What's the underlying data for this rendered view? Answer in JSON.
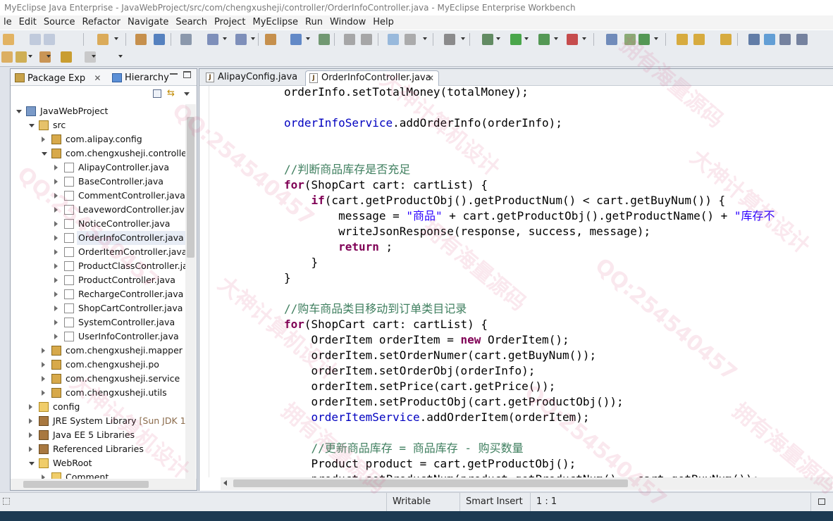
{
  "window": {
    "title": "MyEclipse Java Enterprise - JavaWebProject/src/com/chengxusheji/controller/OrderInfoController.java - MyEclipse Enterprise Workbench"
  },
  "menubar": {
    "items": [
      "le",
      "Edit",
      "Source",
      "Refactor",
      "Navigate",
      "Search",
      "Project",
      "MyEclipse",
      "Run",
      "Window",
      "Help"
    ]
  },
  "package_explorer": {
    "tabs": [
      {
        "label": "Package Exp",
        "icon": "package-icon"
      },
      {
        "label": "Hierarchy",
        "icon": "hierarchy-icon"
      }
    ],
    "tree": [
      {
        "label": "JavaWebProject",
        "icon": "project-icon",
        "expanded": true
      },
      {
        "label": "src",
        "icon": "source-folder-icon",
        "expanded": true
      },
      {
        "label": "com.alipay.config",
        "icon": "package-icon",
        "expanded": false
      },
      {
        "label": "com.chengxusheji.controller",
        "icon": "package-icon",
        "expanded": true
      },
      {
        "label": "AlipayController.java",
        "icon": "java-file-icon",
        "expanded": false
      },
      {
        "label": "BaseController.java",
        "icon": "java-file-icon",
        "expanded": false
      },
      {
        "label": "CommentController.java",
        "icon": "java-file-icon",
        "expanded": false
      },
      {
        "label": "LeavewordController.jav",
        "icon": "java-file-icon",
        "expanded": false
      },
      {
        "label": "NoticeController.java",
        "icon": "java-file-icon",
        "expanded": false
      },
      {
        "label": "OrderInfoController.java",
        "icon": "java-file-icon",
        "expanded": false,
        "selected": true
      },
      {
        "label": "OrderItemController.java",
        "icon": "java-file-icon",
        "expanded": false
      },
      {
        "label": "ProductClassController.ja",
        "icon": "java-file-icon",
        "expanded": false
      },
      {
        "label": "ProductController.java",
        "icon": "java-file-icon",
        "expanded": false
      },
      {
        "label": "RechargeController.java",
        "icon": "java-file-icon",
        "expanded": false
      },
      {
        "label": "ShopCartController.java",
        "icon": "java-file-icon",
        "expanded": false
      },
      {
        "label": "SystemController.java",
        "icon": "java-file-icon",
        "expanded": false
      },
      {
        "label": "UserInfoController.java",
        "icon": "java-file-icon",
        "expanded": false
      },
      {
        "label": "com.chengxusheji.mapper",
        "icon": "package-icon",
        "expanded": false
      },
      {
        "label": "com.chengxusheji.po",
        "icon": "package-icon",
        "expanded": false
      },
      {
        "label": "com.chengxusheji.service",
        "icon": "package-icon",
        "expanded": false
      },
      {
        "label": "com.chengxusheji.utils",
        "icon": "package-icon",
        "expanded": false
      },
      {
        "label": "config",
        "icon": "folder-icon",
        "expanded": false
      },
      {
        "label": "JRE System Library",
        "suffix": "[Sun JDK 1.",
        "icon": "library-icon",
        "expanded": false
      },
      {
        "label": "Java EE 5 Libraries",
        "icon": "library-icon",
        "expanded": false
      },
      {
        "label": "Referenced Libraries",
        "icon": "library-icon",
        "expanded": false
      },
      {
        "label": "WebRoot",
        "icon": "folder-icon",
        "expanded": true
      },
      {
        "label": "Comment",
        "icon": "folder-icon",
        "expanded": false
      }
    ]
  },
  "editor": {
    "tabs": [
      {
        "label": "AlipayConfig.java",
        "active": false
      },
      {
        "label": "OrderInfoController.java",
        "active": true
      }
    ],
    "code_lines": [
      [
        {
          "t": "orderInfo.setTotalMoney(totalMoney);"
        }
      ],
      [],
      [
        {
          "t": "orderInfoService",
          "c": "fld"
        },
        {
          "t": ".addOrderInfo(orderInfo);"
        }
      ],
      [],
      [],
      [
        {
          "t": "//判断商品库存是否充足",
          "c": "cm"
        }
      ],
      [
        {
          "t": "for",
          "c": "kw"
        },
        {
          "t": "(ShopCart cart: cartList) {"
        }
      ],
      [
        {
          "t": "    "
        },
        {
          "t": "if",
          "c": "kw"
        },
        {
          "t": "(cart.getProductObj().getProductNum() < cart.getBuyNum()) {"
        }
      ],
      [
        {
          "t": "        message = "
        },
        {
          "t": "\"商品\"",
          "c": "str"
        },
        {
          "t": " + cart.getProductObj().getProductName() + "
        },
        {
          "t": "\"库存不",
          "c": "str"
        }
      ],
      [
        {
          "t": "        writeJsonResponse(response, success, message);"
        }
      ],
      [
        {
          "t": "        "
        },
        {
          "t": "return",
          "c": "kw"
        },
        {
          "t": " ;"
        }
      ],
      [
        {
          "t": "    }"
        }
      ],
      [
        {
          "t": "}"
        }
      ],
      [],
      [
        {
          "t": "//购车商品类目移动到订单类目记录",
          "c": "cm"
        }
      ],
      [
        {
          "t": "for",
          "c": "kw"
        },
        {
          "t": "(ShopCart cart: cartList) {"
        }
      ],
      [
        {
          "t": "    OrderItem orderItem = "
        },
        {
          "t": "new",
          "c": "kw"
        },
        {
          "t": " OrderItem();"
        }
      ],
      [
        {
          "t": "    orderItem.setOrderNumer(cart.getBuyNum());"
        }
      ],
      [
        {
          "t": "    orderItem.setOrderObj(orderInfo);"
        }
      ],
      [
        {
          "t": "    orderItem.setPrice(cart.getPrice());"
        }
      ],
      [
        {
          "t": "    orderItem.setProductObj(cart.getProductObj());"
        }
      ],
      [
        {
          "t": "    "
        },
        {
          "t": "orderItemService",
          "c": "fld"
        },
        {
          "t": ".addOrderItem(orderItem);"
        }
      ],
      [],
      [
        {
          "t": "    "
        },
        {
          "t": "//更新商品库存 = 商品库存 - 购买数量",
          "c": "cm"
        }
      ],
      [
        {
          "t": "    Product product = cart.getProductObj();"
        }
      ],
      [
        {
          "t": "    product.setProductNum(product.getProductNum() - cart.getBuyNum());"
        }
      ]
    ]
  },
  "statusbar": {
    "writable": "Writable",
    "insert_mode": "Smart Insert",
    "position": "1 : 1"
  },
  "watermark": {
    "texts": [
      "QQ:254540457",
      "大神计算机设计",
      "拥有海量源码"
    ]
  }
}
